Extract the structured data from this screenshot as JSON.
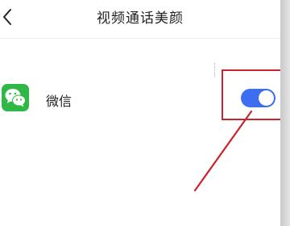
{
  "header": {
    "title": "视频通话美颜",
    "back_icon": "chevron-left-icon"
  },
  "setting_row": {
    "app_icon": "wechat-icon",
    "app_icon_color": "#2fb845",
    "label": "微信",
    "toggle_state": "on",
    "toggle_color": "#3d6ef2"
  },
  "annotation": {
    "highlight_color": "#c8262e"
  }
}
